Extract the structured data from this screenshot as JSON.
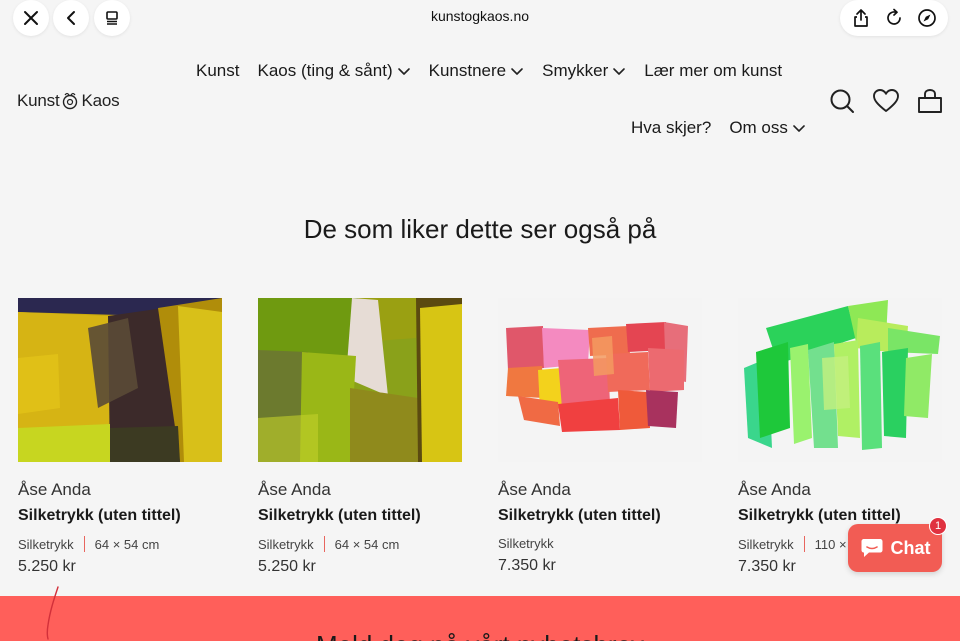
{
  "browser": {
    "url": "kunstogkaos.no"
  },
  "site": {
    "logo_left": "Kunst",
    "logo_right": "Kaos"
  },
  "nav": {
    "items": [
      {
        "label": "Kunst",
        "dropdown": false
      },
      {
        "label": "Kaos (ting & sånt)",
        "dropdown": true
      },
      {
        "label": "Kunstnere",
        "dropdown": true
      },
      {
        "label": "Smykker",
        "dropdown": true
      },
      {
        "label": "Lær mer om kunst",
        "dropdown": false
      }
    ],
    "row2": [
      {
        "label": "Hva skjer?",
        "dropdown": false
      },
      {
        "label": "Om oss",
        "dropdown": true
      }
    ]
  },
  "section": {
    "title": "De som liker dette ser også på"
  },
  "products": [
    {
      "artist": "Åse Anda",
      "title": "Silketrykk (uten tittel)",
      "technique": "Silketrykk",
      "size": "64 × 54 cm",
      "price": "5.250 kr"
    },
    {
      "artist": "Åse Anda",
      "title": "Silketrykk (uten tittel)",
      "technique": "Silketrykk",
      "size": "64 × 54 cm",
      "price": "5.250 kr"
    },
    {
      "artist": "Åse Anda",
      "title": "Silketrykk (uten tittel)",
      "technique": "Silketrykk",
      "size": "",
      "price": "7.350 kr"
    },
    {
      "artist": "Åse Anda",
      "title": "Silketrykk (uten tittel)",
      "technique": "Silketrykk",
      "size": "110 × 1",
      "price": "7.350 kr"
    }
  ],
  "chat": {
    "label": "Chat",
    "badge": "1"
  },
  "newsletter": {
    "title": "Meld deg på vårt nyhetsbrev"
  },
  "colors": {
    "accent": "#ff5f5a",
    "chat": "#f25c54",
    "background": "#f5f5f5"
  }
}
